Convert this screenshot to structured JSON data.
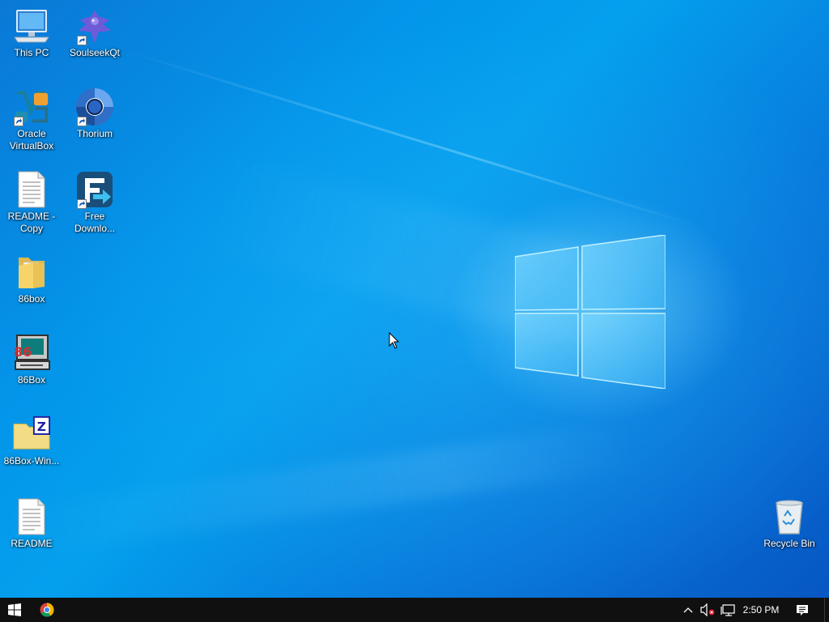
{
  "desktop": {
    "icons": [
      {
        "label": "This PC",
        "icon": "this-pc-icon"
      },
      {
        "label": "SoulseekQt",
        "icon": "soulseekqt-icon"
      },
      {
        "label": "Oracle\nVirtualBox",
        "icon": "virtualbox-icon"
      },
      {
        "label": "Thorium",
        "icon": "thorium-icon"
      },
      {
        "label": "README -\nCopy",
        "icon": "text-document-icon"
      },
      {
        "label": "Free\nDownlo...",
        "icon": "free-download-manager-icon"
      },
      {
        "label": "86box",
        "icon": "folder-icon"
      },
      {
        "label": "86Box",
        "icon": "86box-computer-icon"
      },
      {
        "label": "86Box-Win...",
        "icon": "zip-archive-icon"
      },
      {
        "label": "README",
        "icon": "text-document-icon"
      },
      {
        "label": "Recycle Bin",
        "icon": "recycle-bin-icon"
      }
    ]
  },
  "taskbar": {
    "start_icon": "windows-start-icon",
    "pinned": [
      {
        "icon": "chrome-icon"
      }
    ],
    "tray": {
      "overflow_icon": "chevron-up-icon",
      "volume_icon": "volume-muted-icon",
      "network_icon": "network-icon",
      "time": "2:50 PM",
      "notifications_icon": "action-center-icon"
    }
  },
  "colors": {
    "wallpaper_blue": "#0396ea",
    "taskbar_bg": "#101010",
    "text": "#ffffff"
  }
}
